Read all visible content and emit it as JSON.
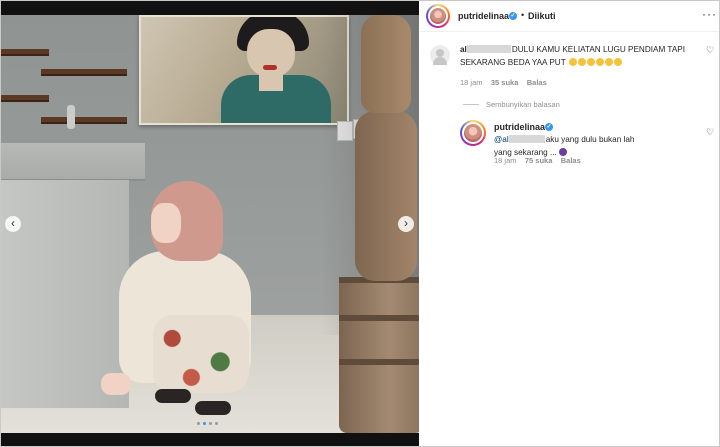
{
  "post": {
    "carousel": {
      "prev_icon": "chevron-left-icon",
      "next_icon": "chevron-right-icon",
      "dot_count": 4,
      "active_dot": 1
    }
  },
  "header": {
    "username": "putridelinaa",
    "separator": "•",
    "follow_status": "Diikuti",
    "more_icon": "more-icon"
  },
  "comments": [
    {
      "username_prefix": "al",
      "text": "DULU KAMU KELIATAN LUGU PENDIAM TAPI SEKARANG BEDA YAA PUT",
      "emoji_count": 6,
      "time": "18 jam",
      "likes": "35 suka",
      "reply_label": "Balas",
      "hide_replies_label": "Sembunyikan balasan"
    }
  ],
  "reply": {
    "username": "putridelinaa",
    "mention_prefix": "@al",
    "text_line1": "aku yang dulu bukan lah",
    "text_line2": "yang sekarang ...",
    "time": "18 jam",
    "likes": "75 suka",
    "reply_label": "Balas"
  },
  "colors": {
    "verified": "#3897f0",
    "text": "#262626",
    "meta": "#8e8e8e",
    "active_dot": "#3797f0"
  }
}
